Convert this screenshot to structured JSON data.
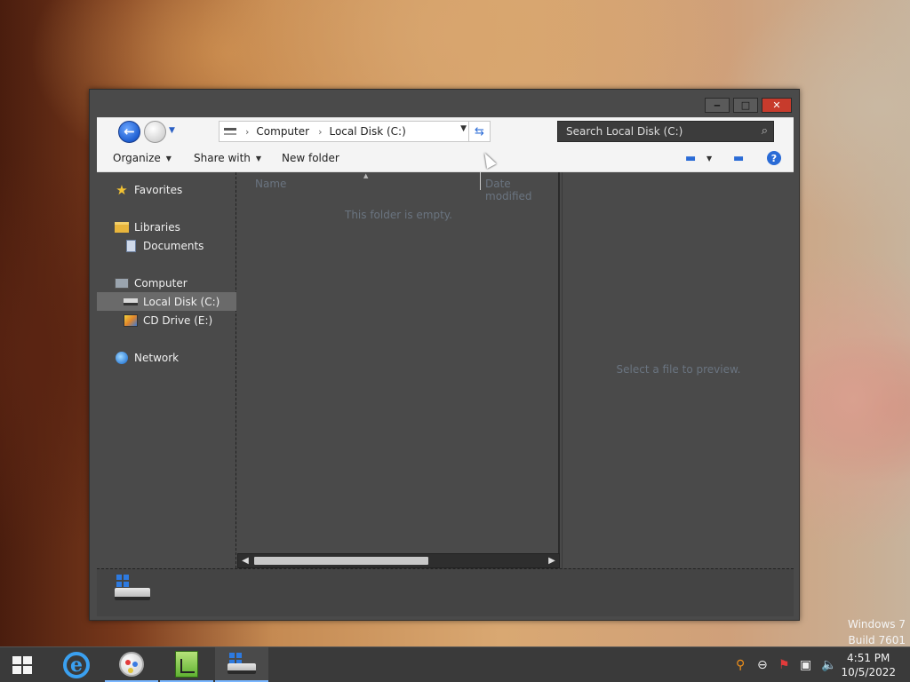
{
  "window": {
    "controls": {
      "minimize": "‒",
      "maximize": "□",
      "close": "✕"
    }
  },
  "navbar": {
    "breadcrumb": [
      "Computer",
      "Local Disk (C:)"
    ],
    "search_placeholder": "Search Local Disk (C:)"
  },
  "commandbar": {
    "organize": "Organize",
    "share_with": "Share with",
    "new_folder": "New folder"
  },
  "navpane": {
    "items": [
      {
        "label": "Favorites",
        "icon": "star-icon"
      },
      {
        "label": "Libraries",
        "icon": "folder-icon"
      },
      {
        "label": "Documents",
        "icon": "document-icon"
      },
      {
        "label": "Computer",
        "icon": "computer-icon"
      },
      {
        "label": "Local Disk (C:)",
        "icon": "disk-icon",
        "selected": true
      },
      {
        "label": "CD Drive (E:)",
        "icon": "cd-icon"
      },
      {
        "label": "Network",
        "icon": "network-icon"
      }
    ]
  },
  "content": {
    "columns": [
      "Name",
      "Date modified"
    ],
    "empty_message": "This folder is empty."
  },
  "preview": {
    "message": "Select a file to preview."
  },
  "watermark": {
    "line1": "Windows 7",
    "line2": "Build 7601"
  },
  "taskbar": {
    "apps": [
      {
        "name": "Internet Explorer",
        "icon": "ie-icon"
      },
      {
        "name": "Paint",
        "icon": "paint-icon"
      },
      {
        "name": "Notepad++",
        "icon": "notepad-icon"
      },
      {
        "name": "Windows Explorer",
        "icon": "explorer-icon",
        "active": true
      }
    ],
    "clock": {
      "time": "4:51 PM",
      "date": "10/5/2022"
    }
  },
  "colors": {
    "window_bg": "#4a4a4a",
    "toolbar_bg": "#f4f4f4",
    "accent": "#2a6bd6",
    "close_red": "#c73b2c"
  }
}
